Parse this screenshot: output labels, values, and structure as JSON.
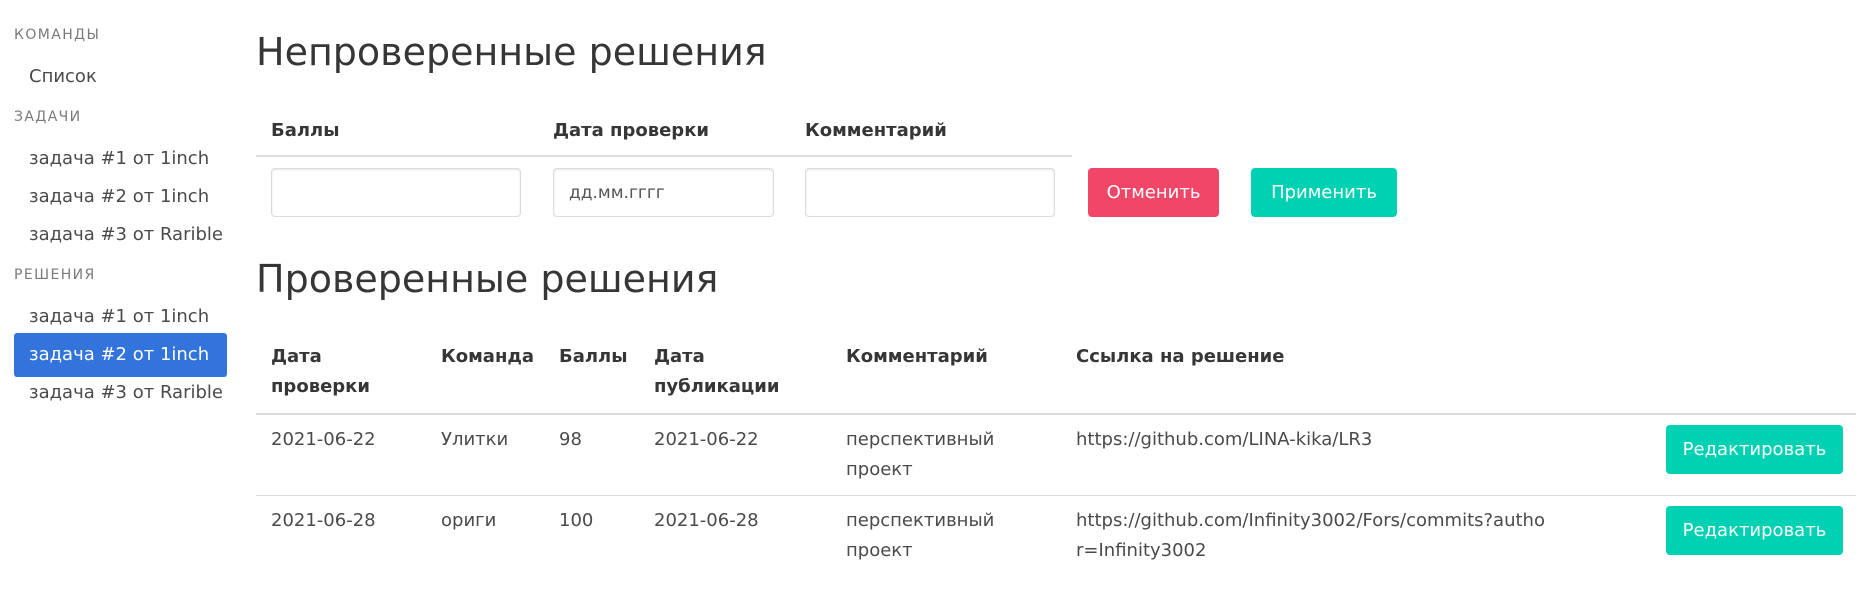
{
  "sidebar": {
    "teams_label": "КОМАНДЫ",
    "teams_items": [
      {
        "label": "Список"
      }
    ],
    "tasks_label": "ЗАДАЧИ",
    "tasks_items": [
      {
        "label": "задача #1 от 1inch"
      },
      {
        "label": "задача #2 от 1inch"
      },
      {
        "label": "задача #3 от Rarible"
      }
    ],
    "solutions_label": "РЕШЕНИЯ",
    "solutions_items": [
      {
        "label": "задача #1 от 1inch"
      },
      {
        "label": "задача #2 от 1inch"
      },
      {
        "label": "задача #3 от Rarible"
      }
    ],
    "active_solution": 1
  },
  "unverified": {
    "title": "Непроверенные решения",
    "columns": [
      "Баллы",
      "Дата проверки",
      "Комментарий"
    ],
    "score_value": "",
    "date_placeholder": "дд.мм.гггг",
    "comment_value": "",
    "cancel_label": "Отменить",
    "apply_label": "Применить"
  },
  "verified": {
    "title": "Проверенные решения",
    "columns": {
      "check_date": "Дата проверки",
      "team": "Команда",
      "score": "Баллы",
      "pub_date": "Дата публикации",
      "comment": "Комментарий",
      "link": "Ссылка на решение"
    },
    "rows": [
      {
        "check_date": "2021-06-22",
        "team": "Улитки",
        "score": "98",
        "pub_date": "2021-06-22",
        "comment": "перспективный проект",
        "link": "https://github.com/LINA-kika/LR3",
        "edit_label": "Редактировать"
      },
      {
        "check_date": "2021-06-28",
        "team": "ориги",
        "score": "100",
        "pub_date": "2021-06-28",
        "comment": "перспективный проект",
        "link": "https://github.com/Infinity3002/Fors/commits?author=Infinity3002",
        "edit_label": "Редактировать"
      }
    ]
  },
  "colors": {
    "active": "#3273dc",
    "danger": "#f14668",
    "primary": "#00d1b2"
  }
}
